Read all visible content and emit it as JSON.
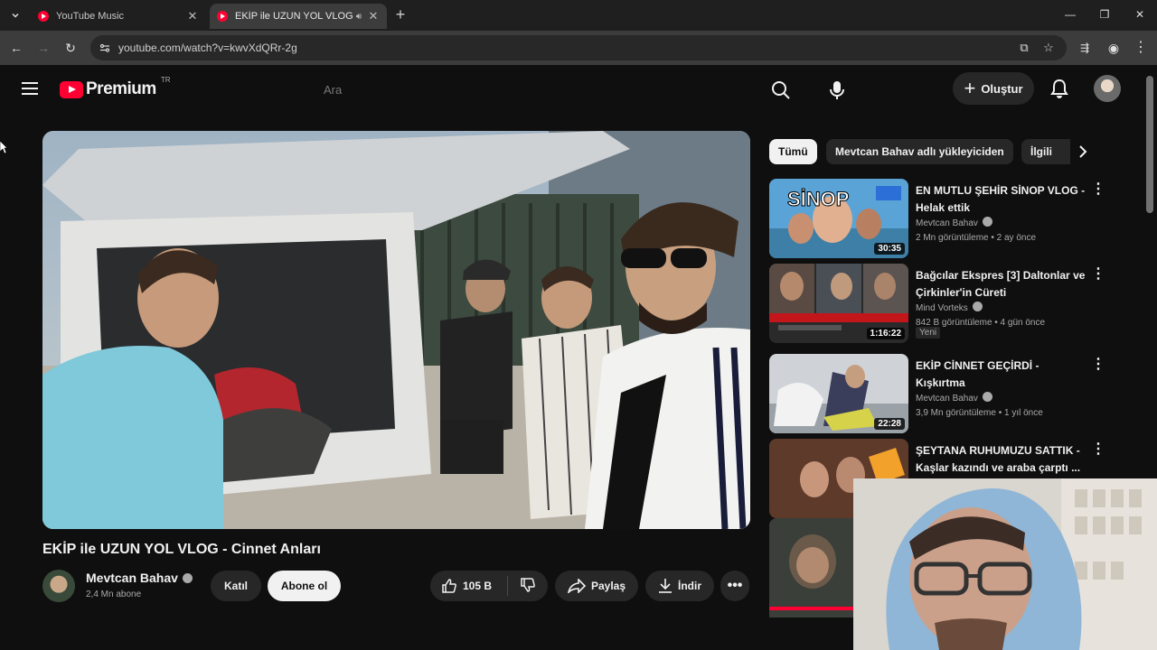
{
  "browser": {
    "tabs": [
      {
        "title": "YouTube Music",
        "active": false
      },
      {
        "title": "EKİP ile UZUN YOL VLOG - ",
        "active": true
      }
    ],
    "url": "youtube.com/watch?v=kwvXdQRr-2g"
  },
  "header": {
    "logo_text": "Premium",
    "logo_country": "TR",
    "search_placeholder": "Ara",
    "create_label": "Oluştur"
  },
  "video": {
    "title": "EKİP ile UZUN YOL VLOG - Cinnet Anları",
    "channel": "Mevtcan Bahav",
    "subscribers": "2,4 Mn abone",
    "join_label": "Katıl",
    "subscribe_label": "Abone ol",
    "likes": "105 B",
    "share_label": "Paylaş",
    "download_label": "İndir"
  },
  "chips": [
    "Tümü",
    "Mevtcan Bahav adlı yükleyiciden",
    "İlgili"
  ],
  "recommendations": [
    {
      "title": "EN MUTLU ŞEHİR SİNOP VLOG - Helak ettik",
      "channel": "Mevtcan Bahav",
      "meta": "2 Mn görüntüleme • 2 ay önce",
      "duration": "30:35",
      "thumb_text": "SİNOP",
      "badge": ""
    },
    {
      "title": "Bağcılar Ekspres [3] Daltonlar ve Çirkinler'in Cüreti",
      "channel": "Mind Vorteks",
      "meta": "842 B görüntüleme • 4 gün önce",
      "duration": "1:16:22",
      "thumb_text": "",
      "badge": "Yeni"
    },
    {
      "title": "EKİP CİNNET GEÇİRDİ - Kışkırtma",
      "channel": "Mevtcan Bahav",
      "meta": "3,9 Mn görüntüleme • 1 yıl önce",
      "duration": "22:28",
      "thumb_text": "",
      "badge": ""
    },
    {
      "title": "ŞEYTANA RUHUMUZU SATTIK - Kaşlar kazındı ve araba çarptı ...",
      "channel": "",
      "meta": "",
      "duration": "",
      "thumb_text": "",
      "badge": ""
    }
  ],
  "colors": {
    "brand": "#ff0033",
    "bg": "#0f0f0f",
    "chip": "#272727"
  }
}
